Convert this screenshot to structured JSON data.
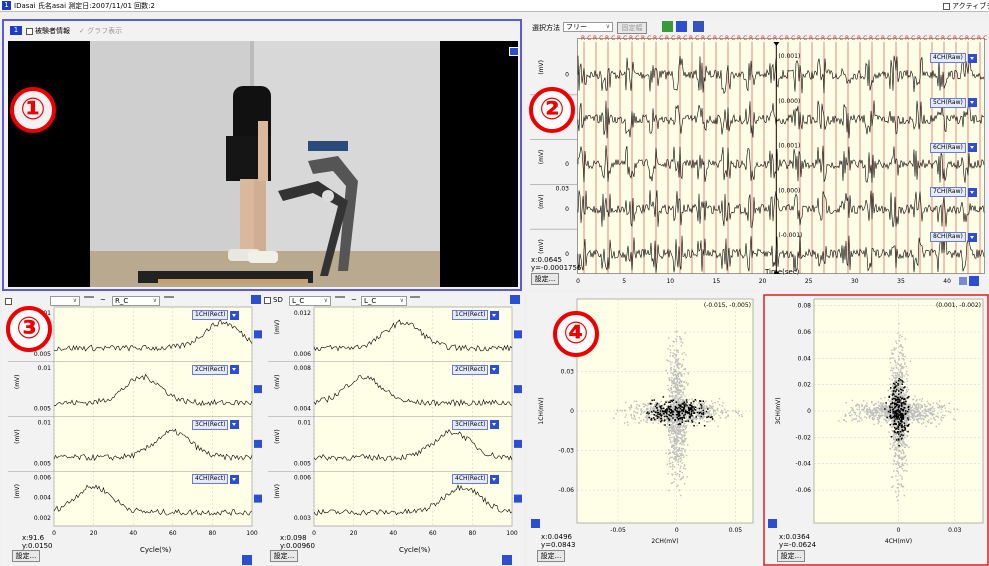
{
  "titlebar": {
    "num": "1",
    "title": "IDasai 氏名asai 測定日:2007/11/01 回数:2",
    "active_label": "アクティブデー"
  },
  "panel1": {
    "num": "1",
    "subject_info": "被験者情報",
    "graph_display": "グラフ表示",
    "badge": "①"
  },
  "panel2": {
    "badge": "②",
    "select_method_label": "選択方法",
    "select_method_value": "フリー",
    "fixed_width_label": "固定幅",
    "rc_marker": "R C",
    "channels": [
      {
        "label": "4CH(Raw)",
        "value": "0.001",
        "ylabel": "(mV)"
      },
      {
        "label": "5CH(Raw)",
        "value": "0.000",
        "ylabel": "(mV)"
      },
      {
        "label": "6CH(Raw)",
        "value": "0.001",
        "ylabel": "(mV)"
      },
      {
        "label": "7CH(Raw)",
        "value": "0.000",
        "ylabel": "(mV)"
      },
      {
        "label": "8CH(Raw)",
        "value": "-0.001",
        "ylabel": "(mV)"
      }
    ],
    "tick_zero": "0",
    "tick_003": "0.03",
    "x_ticks": [
      "0",
      "5",
      "10",
      "15",
      "20",
      "25",
      "30",
      "35",
      "40"
    ],
    "xlabel": "Time(sec)",
    "xy_readout_x": "x:0.0645",
    "xy_readout_y": "y=-0.0001756",
    "settings": "設定..."
  },
  "panel3": {
    "badge": "③",
    "left_select": "R_C",
    "right_sd": "SD",
    "right_select_a": "L_C",
    "right_select_b": "L_C",
    "tilde": "~",
    "left_channels": [
      {
        "label": "1CH(Rect)",
        "ticks": [
          "0.01",
          "0.005"
        ]
      },
      {
        "label": "2CH(Rect)",
        "ticks": [
          "0.01",
          "0.005"
        ]
      },
      {
        "label": "3CH(Rect)",
        "ticks": [
          "0.01",
          "0.005"
        ]
      },
      {
        "label": "4CH(Rect)",
        "ticks": [
          "0.006",
          "0.004",
          "0.002"
        ]
      }
    ],
    "right_channels": [
      {
        "label": "1CH(Rect)",
        "ticks": [
          "0.012",
          "0.006"
        ]
      },
      {
        "label": "2CH(Rect)",
        "ticks": [
          "0.008",
          "0.004"
        ]
      },
      {
        "label": "3CH(Rect)",
        "ticks": [
          "0.01",
          "0.005"
        ]
      },
      {
        "label": "4CH(Rect)",
        "ticks": [
          "0.006",
          "0.003"
        ]
      }
    ],
    "ylabel": "(mV)",
    "x_ticks": [
      "0",
      "20",
      "40",
      "60",
      "80",
      "100"
    ],
    "xlabel": "Cycle(%)",
    "left_readout_x": "x:91.6",
    "left_readout_y": "y:0.0150",
    "right_readout_x": "x:0.098",
    "right_readout_y": "y:0.00960",
    "settings": "設定..."
  },
  "panel4": {
    "badge": "④",
    "left": {
      "corner": "(-0.015, -0.005)",
      "y_ticks": [
        "0.06",
        "0.03",
        "0",
        "-0.03",
        "-0.06"
      ],
      "x_ticks": [
        "-0.05",
        "0",
        "0.05"
      ],
      "xlabel": "2CH(mV)",
      "ylabel": "1CH(mV)",
      "readout_x": "x:0.0496",
      "readout_y": "y=0.0843"
    },
    "right": {
      "corner": "(0.001, -0.002)",
      "y_ticks": [
        "0.08",
        "0.06",
        "0.04",
        "0.02",
        "0",
        "-0.02",
        "-0.04",
        "-0.06"
      ],
      "x_ticks": [
        "0",
        "0.03"
      ],
      "xlabel": "4CH(mV)",
      "ylabel": "3CH(mV)",
      "readout_x": "x:0.0364",
      "readout_y": "y=-0.0624"
    },
    "settings": "設定..."
  },
  "colors": {
    "panel_border": "#5b5bd6",
    "plot_bg": "#ffffe8",
    "badge": "#e00000",
    "marker_line": "#e05050",
    "selected_border": "#e02020"
  }
}
